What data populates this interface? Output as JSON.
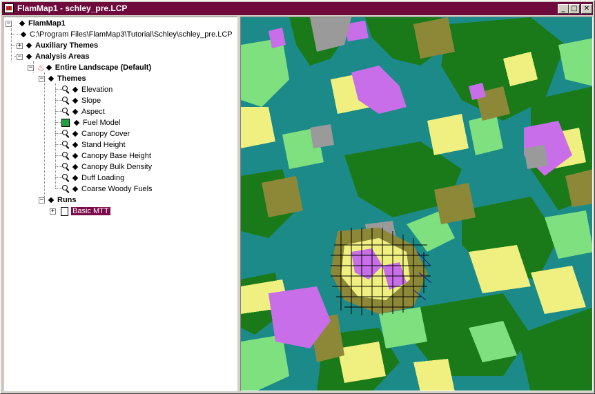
{
  "window": {
    "title": "FlamMap1 - schley_pre.LCP",
    "controls": {
      "minimize": "_",
      "maximize": "□",
      "close": "✕"
    }
  },
  "tree": {
    "root": "FlamMap1",
    "landscape_path": "C:\\Program Files\\FlamMap3\\Tutorial\\Schley\\schley_pre.LCP",
    "auxiliary_themes": "Auxiliary Themes",
    "analysis_areas": "Analysis Areas",
    "entire_landscape": "Entire Landscape (Default)",
    "themes_label": "Themes",
    "themes": [
      "Elevation",
      "Slope",
      "Aspect",
      "Fuel Model",
      "Canopy Cover",
      "Stand Height",
      "Canopy Base Height",
      "Canopy Bulk Density",
      "Duff Loading",
      "Coarse Woody Fuels"
    ],
    "runs_label": "Runs",
    "runs": [
      "Basic MTT"
    ]
  },
  "map": {
    "colors": {
      "teal": "#1d8a8a",
      "dark_green": "#1a7a1a",
      "light_green": "#7ee07e",
      "yellow": "#f0f080",
      "olive": "#8c8838",
      "purple": "#c86ee8",
      "gray": "#9a9a9a"
    }
  }
}
